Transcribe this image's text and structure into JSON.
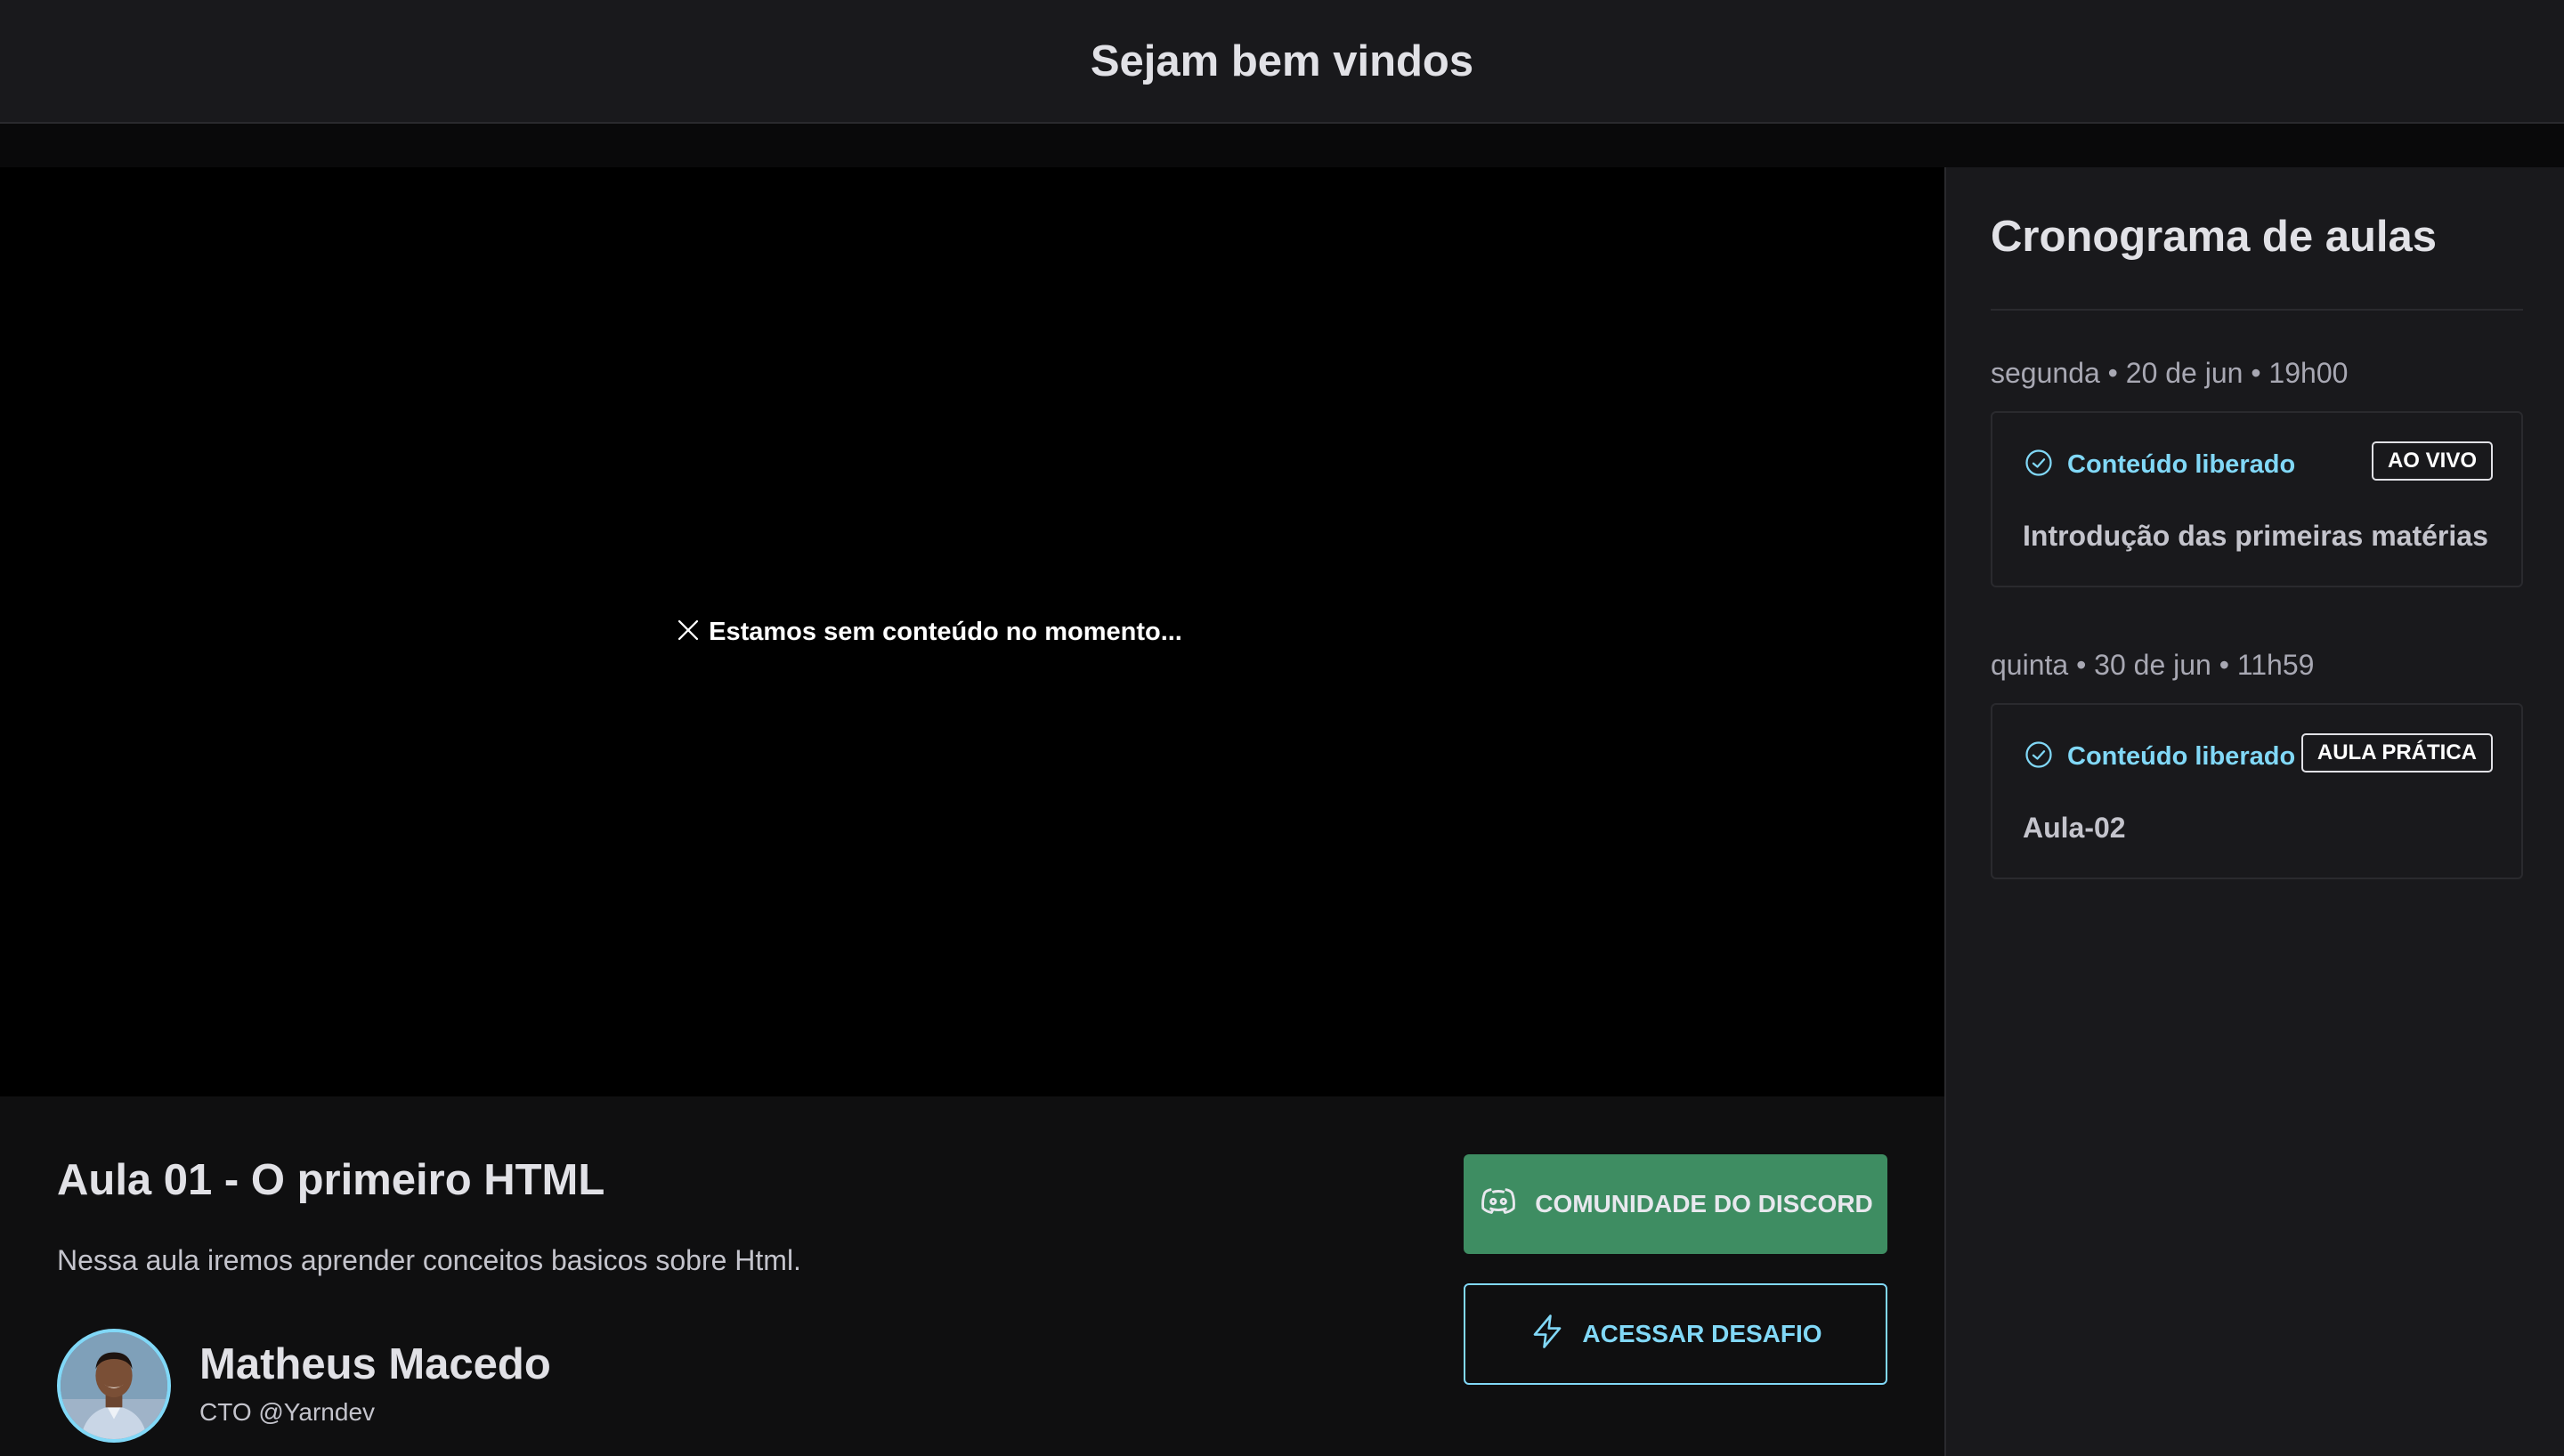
{
  "header": {
    "title": "Sejam bem vindos"
  },
  "video": {
    "empty_message": "Estamos sem conteúdo no momento..."
  },
  "lesson": {
    "title": "Aula 01 - O primeiro HTML",
    "description": "Nessa aula iremos aprender conceitos basicos sobre Html.",
    "instructor": {
      "name": "Matheus Macedo",
      "role": "CTO @Yarndev"
    }
  },
  "actions": {
    "discord_label": "COMUNIDADE DO DISCORD",
    "challenge_label": "ACESSAR DESAFIO"
  },
  "sidebar": {
    "title": "Cronograma de aulas",
    "lessons": [
      {
        "date": "segunda • 20 de jun • 19h00",
        "status": "Conteúdo liberado",
        "badge": "AO VIVO",
        "title": "Introdução das primeiras matérias"
      },
      {
        "date": "quinta • 30 de jun • 11h59",
        "status": "Conteúdo liberado",
        "badge": "AULA PRÁTICA",
        "title": "Aula-02"
      }
    ]
  },
  "colors": {
    "accent_blue": "#81d8f7",
    "discord_green": "#3e8d62",
    "background": "#09090a",
    "panel": "#19191c"
  },
  "icons": [
    "close-icon",
    "discord-icon",
    "lightning-icon",
    "check-circle-icon"
  ]
}
